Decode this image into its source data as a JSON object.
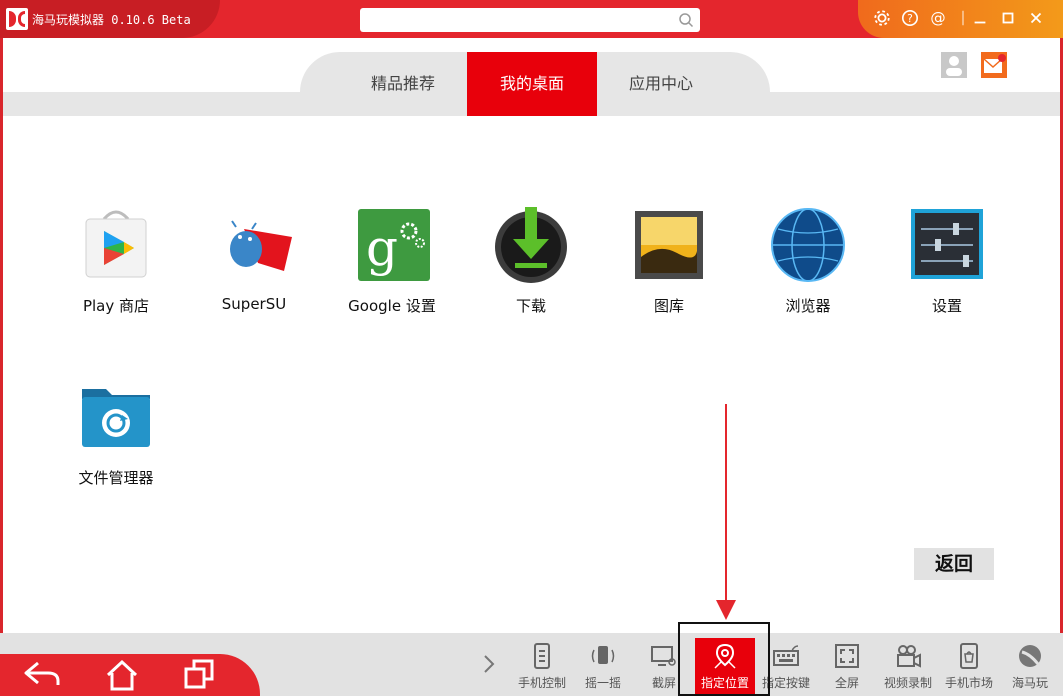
{
  "app": {
    "title": "海马玩模拟器 0.10.6 Beta",
    "search_placeholder": ""
  },
  "tabs": [
    {
      "label": "精品推荐"
    },
    {
      "label": "我的桌面"
    },
    {
      "label": "应用中心"
    }
  ],
  "apps": [
    {
      "label": "Play 商店"
    },
    {
      "label": "SuperSU"
    },
    {
      "label": "Google 设置"
    },
    {
      "label": "下载"
    },
    {
      "label": "图库"
    },
    {
      "label": "浏览器"
    },
    {
      "label": "设置"
    },
    {
      "label": "文件管理器"
    }
  ],
  "back_button": "返回",
  "toolbar": [
    {
      "label": "手机控制",
      "icon": "phone-control-icon"
    },
    {
      "label": "摇一摇",
      "icon": "shake-icon"
    },
    {
      "label": "截屏",
      "icon": "screenshot-icon"
    },
    {
      "label": "指定位置",
      "icon": "location-icon"
    },
    {
      "label": "指定按键",
      "icon": "keyboard-icon"
    },
    {
      "label": "全屏",
      "icon": "fullscreen-icon"
    },
    {
      "label": "视频录制",
      "icon": "video-record-icon"
    },
    {
      "label": "手机市场",
      "icon": "market-icon"
    },
    {
      "label": "海马玩",
      "icon": "haimawan-icon"
    }
  ],
  "colors": {
    "accent": "#e4262d",
    "active_tab": "#e8000b",
    "window_controls": "#f39a1a"
  }
}
